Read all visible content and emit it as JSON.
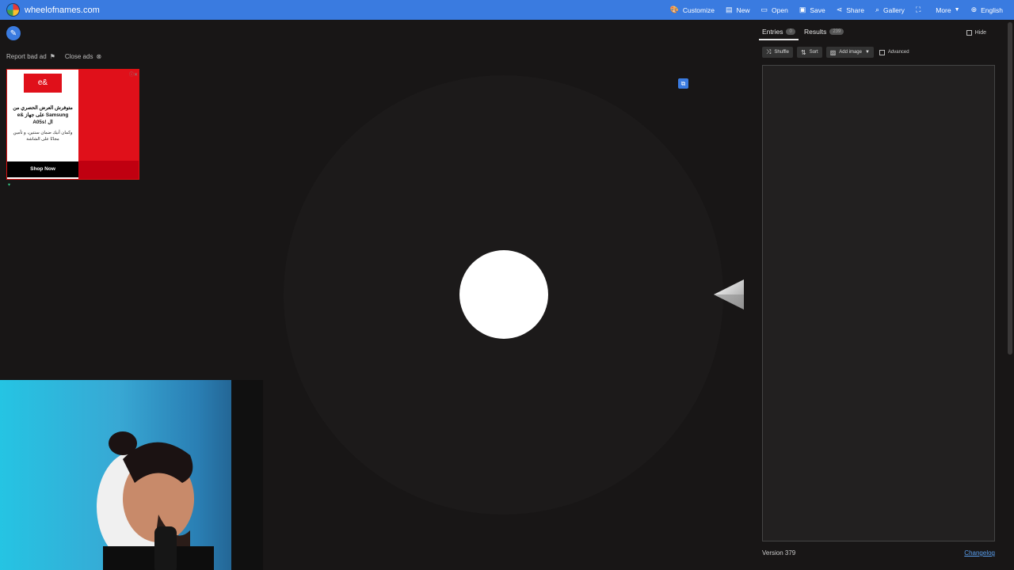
{
  "topbar": {
    "site_name": "wheelofnames.com",
    "nav": [
      {
        "icon": "palette-icon",
        "label": "Customize"
      },
      {
        "icon": "file-icon",
        "label": "New"
      },
      {
        "icon": "folder-icon",
        "label": "Open"
      },
      {
        "icon": "save-icon",
        "label": "Save"
      },
      {
        "icon": "share-icon",
        "label": "Share"
      },
      {
        "icon": "search-icon",
        "label": "Gallery"
      },
      {
        "icon": "fullscreen-icon",
        "label": ""
      },
      {
        "icon": "chevron-down-icon",
        "label": "More"
      },
      {
        "icon": "globe-icon",
        "label": "English"
      }
    ]
  },
  "ads": {
    "report_label": "Report bad ad",
    "close_label": "Close ads",
    "ad_logo": "e&",
    "ad_headline": "متوفرش العرض الحصري من e& على جهاز Samsung A05s! ال",
    "ad_body": "وكمان أنيك ضمان سنتين، و تأمين مجانًا على الشاشة",
    "ad_cta": "Shop Now"
  },
  "panel": {
    "tab_entries": "Entries",
    "entries_count": "0",
    "tab_results": "Results",
    "results_count": "239",
    "hide_label": "Hide",
    "shuffle_label": "Shuffle",
    "sort_label": "Sort",
    "add_image_label": "Add image",
    "advanced_label": "Advanced",
    "version": "Version 379",
    "changelog": "Changelog"
  },
  "colors": {
    "accent": "#3a7be0",
    "background": "#181616"
  }
}
